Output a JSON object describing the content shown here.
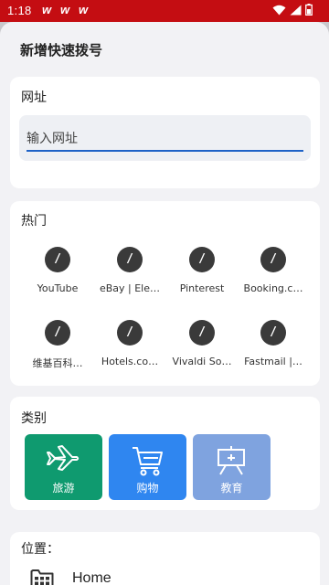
{
  "status_bar": {
    "time": "1:18",
    "notification_icons": [
      "notification-icon",
      "notification-icon",
      "notification-icon"
    ],
    "status_icons": [
      "wifi-icon",
      "signal-icon",
      "battery-icon"
    ]
  },
  "sheet": {
    "title": "新增快速拨号"
  },
  "url_section": {
    "label": "网址",
    "placeholder": "输入网址",
    "value": ""
  },
  "hot_section": {
    "label": "热门",
    "icon_glyph": "/",
    "items": [
      {
        "label": "YouTube"
      },
      {
        "label": "eBay | Ele…"
      },
      {
        "label": "Pinterest"
      },
      {
        "label": "Booking.c…"
      },
      {
        "label": "维基百科…"
      },
      {
        "label": "Hotels.co…"
      },
      {
        "label": "Vivaldi So…"
      },
      {
        "label": "Fastmail |…"
      }
    ]
  },
  "category_section": {
    "label": "类别",
    "items": [
      {
        "label": "旅游",
        "icon": "airplane-icon",
        "color": "#0f9a6f"
      },
      {
        "label": "购物",
        "icon": "shopping-cart-icon",
        "color": "#2f86f0"
      },
      {
        "label": "教育",
        "icon": "easel-icon",
        "color": "#7fa3df"
      }
    ]
  },
  "location_section": {
    "label": "位置：",
    "folder_icon": "speed-dial-folder-icon",
    "folder_name": "Home"
  },
  "colors": {
    "status_bar": "#c40d12",
    "accent": "#1f63c7",
    "sheet_background": "#f2f2f5"
  }
}
